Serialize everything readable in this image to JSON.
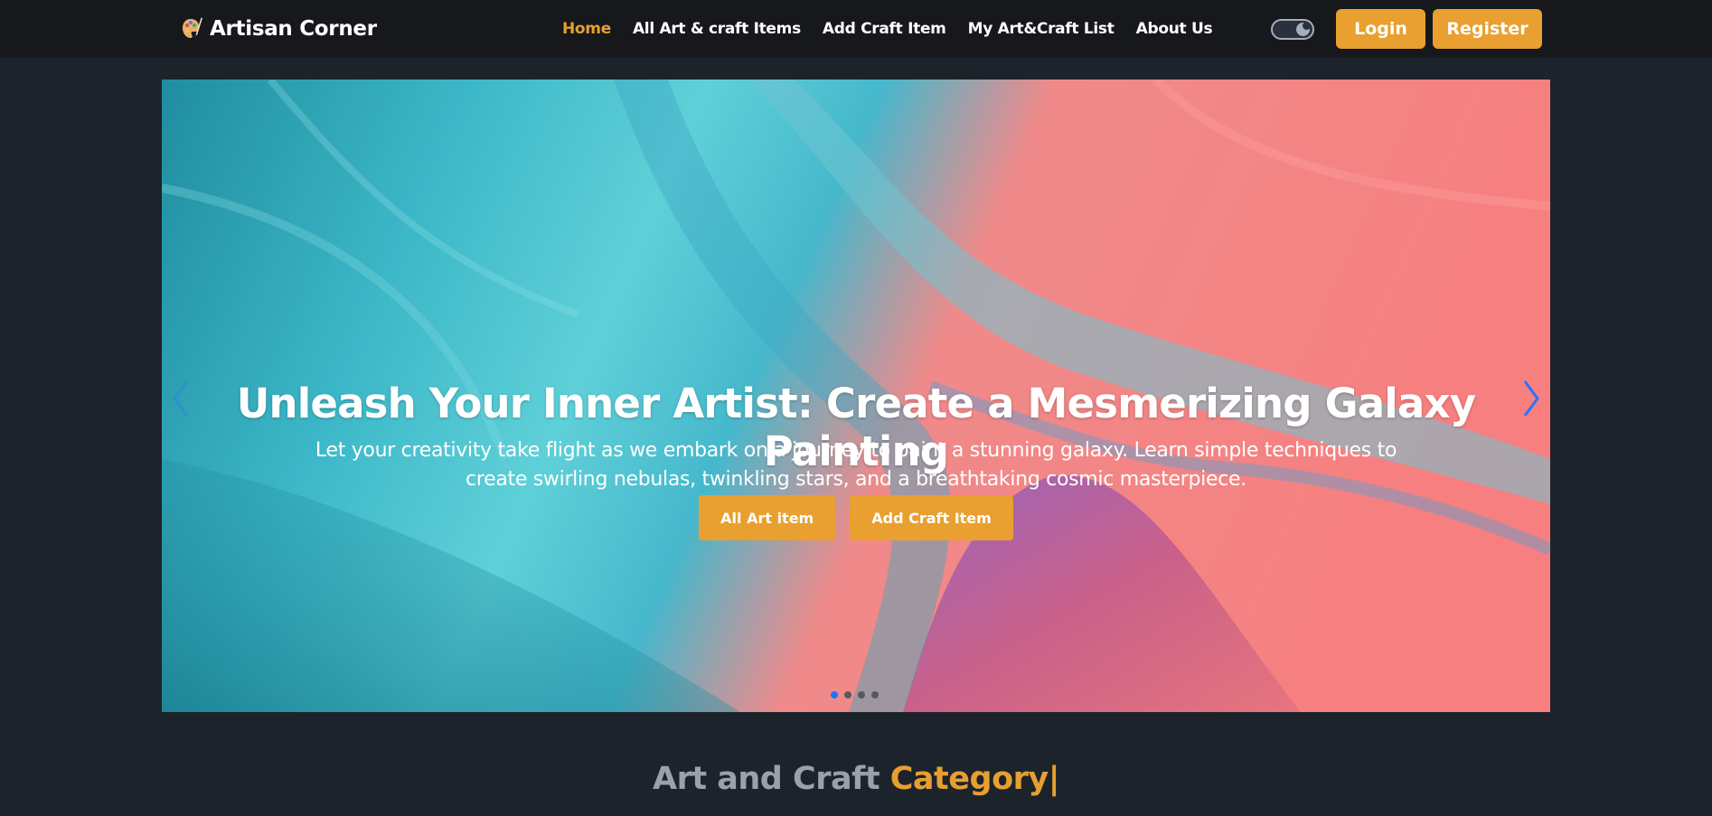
{
  "header": {
    "brand_name": "Artisan Corner",
    "brand_icon": "palette-icon",
    "nav": [
      {
        "label": "Home",
        "active": true
      },
      {
        "label": "All Art & craft Items",
        "active": false
      },
      {
        "label": "Add Craft Item",
        "active": false
      },
      {
        "label": "My Art&Craft List",
        "active": false
      },
      {
        "label": "About Us",
        "active": false
      }
    ],
    "theme_toggle_icon": "theme-toggle-icon",
    "login_label": "Login",
    "register_label": "Register"
  },
  "hero": {
    "title": "Unleash Your Inner Artist: Create a Mesmerizing Galaxy Painting",
    "description": "Let your creativity take flight as we embark on a journey to paint a stunning galaxy. Learn simple techniques to create swirling nebulas, twinkling stars, and a breathtaking cosmic masterpiece.",
    "primary_button": "All Art item",
    "secondary_button": "Add Craft Item",
    "prev_icon": "chevron-left-icon",
    "next_icon": "chevron-right-icon",
    "slide_count": 4,
    "active_slide": 1
  },
  "section": {
    "title_prefix": "Art and Craft ",
    "title_accent": "Category|"
  },
  "colors": {
    "accent": "#e9a030",
    "background": "#1d232a",
    "navbar": "#16181b",
    "active_dot": "#1d72ff"
  }
}
